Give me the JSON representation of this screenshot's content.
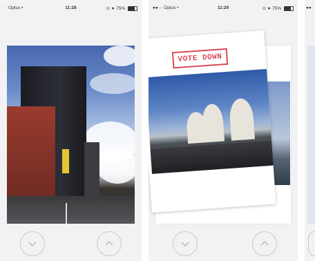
{
  "screens": [
    {
      "status": {
        "carrier": "·· Optus •",
        "time": "11:28",
        "indicators": "⊙ ➤ 75%",
        "battery_level": 0.75
      },
      "photo_icon": "city-street-photo",
      "buttons": {
        "down_icon": "chevron-down-icon",
        "up_icon": "chevron-up-icon"
      }
    },
    {
      "status": {
        "carrier": "●●··· Optus •",
        "time": "11:29",
        "indicators": "⊙ ➤ 75%",
        "battery_level": 0.75
      },
      "stamp": "VOTE DOWN",
      "photo_icon": "opera-house-photo",
      "buttons": {
        "down_icon": "chevron-down-icon",
        "up_icon": "chevron-up-icon"
      }
    },
    {
      "status": {
        "carrier": "●●"
      }
    }
  ],
  "colors": {
    "background": "#f2f2f4",
    "stamp": "#d94a55",
    "button_border": "#c9c9cd"
  }
}
